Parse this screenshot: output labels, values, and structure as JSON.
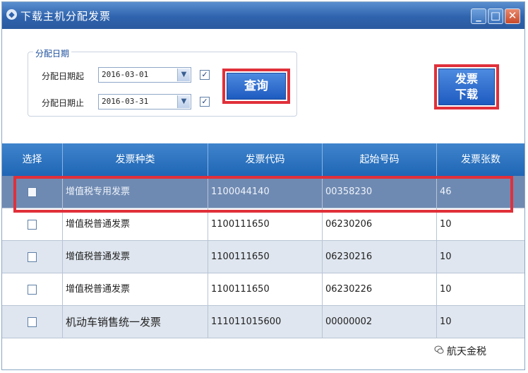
{
  "window": {
    "title": "下载主机分配发票",
    "min_glyph": "_",
    "max_glyph": "□",
    "close_glyph": "✕"
  },
  "date_group": {
    "legend": "分配日期",
    "start_label": "分配日期起",
    "start_value": "2016-03-01",
    "start_checked": "✓",
    "end_label": "分配日期止",
    "end_value": "2016-03-31",
    "end_checked": "✓"
  },
  "buttons": {
    "query": "查询",
    "download_line1": "发票",
    "download_line2": "下载"
  },
  "table": {
    "headers": [
      "选择",
      "发票种类",
      "发票代码",
      "起始号码",
      "发票张数"
    ],
    "rows": [
      {
        "type": "增值税专用发票",
        "code": "1100044140",
        "start": "00358230",
        "count": "46"
      },
      {
        "type": "增值税普通发票",
        "code": "1100111650",
        "start": "06230206",
        "count": "10"
      },
      {
        "type": "增值税普通发票",
        "code": "1100111650",
        "start": "06230216",
        "count": "10"
      },
      {
        "type": "增值税普通发票",
        "code": "1100111650",
        "start": "06230226",
        "count": "10"
      },
      {
        "type": "机动车销售统一发票",
        "code": "111011015600",
        "start": "00000002",
        "count": "10"
      }
    ]
  },
  "watermark": "航天金税",
  "colors": {
    "highlight": "#e0303a",
    "header_blue": "#1f66b5",
    "selected_row": "#6f8ab2"
  }
}
